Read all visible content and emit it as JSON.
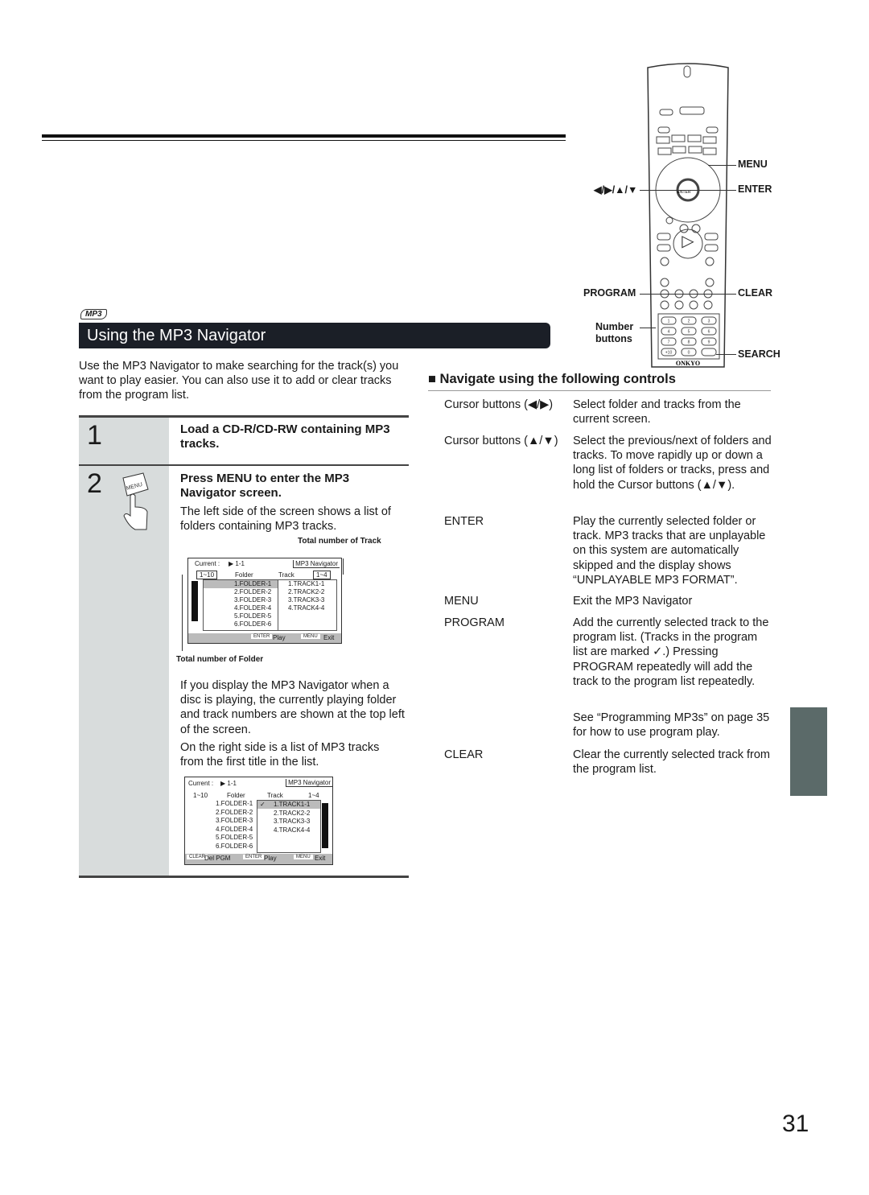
{
  "logo": "MP3",
  "title": "Using the MP3 Navigator",
  "intro": "Use the MP3 Navigator to make searching for the track(s) you want to play easier. You can also use it to add or clear tracks from the program list.",
  "steps": [
    {
      "number": "1",
      "heading": "Load a CD-R/CD-RW containing MP3 tracks."
    },
    {
      "number": "2",
      "heading": "Press MENU to enter the MP3 Navigator screen.",
      "icon_label": "MENU",
      "text1": "The left side of the screen shows a list of folders containing MP3 tracks.",
      "text2": "If you display the MP3 Navigator when a disc is playing, the currently playing folder and track numbers are shown at the top left of the screen.",
      "text3": "On the right side is a list of MP3 tracks from the first title in the list."
    }
  ],
  "callouts": {
    "tracks": "Total number of Track",
    "folders": "Total number of Folder"
  },
  "screen1": {
    "current": "Current :",
    "current_value": "▶ 1-1",
    "tab": "MP3 Navigator",
    "folder_range": "1~10",
    "folder_hdr": "Folder",
    "track_hdr": "Track",
    "track_range": "1~4",
    "folders": [
      "1.FOLDER-1",
      "2.FOLDER-2",
      "3.FOLDER-3",
      "4.FOLDER-4",
      "5.FOLDER-5",
      "6.FOLDER-6"
    ],
    "tracks": [
      "1.TRACK1-1",
      "2.TRACK2-2",
      "3.TRACK3-3",
      "4.TRACK4-4"
    ],
    "enter": "ENTER",
    "play": "Play",
    "menu": "MENU",
    "exit": "Exit"
  },
  "screen2": {
    "current": "Current :",
    "current_value": "▶ 1-1",
    "tab": "MP3 Navigator",
    "folder_range": "1~10",
    "folder_hdr": "Folder",
    "track_hdr": "Track",
    "track_range": "1~4",
    "check": "✓",
    "folders": [
      "1.FOLDER-1",
      "2.FOLDER-2",
      "3.FOLDER-3",
      "4.FOLDER-4",
      "5.FOLDER-5",
      "6.FOLDER-6"
    ],
    "tracks": [
      "1.TRACK1-1",
      "2.TRACK2-2",
      "3.TRACK3-3",
      "4.TRACK4-4"
    ],
    "clear": "CLEAR",
    "delpgm": "Del PGM",
    "enter": "ENTER",
    "play": "Play",
    "menu": "MENU",
    "exit": "Exit"
  },
  "remote": {
    "brand": "ONKYO",
    "labels": {
      "menu": "MENU",
      "enter": "ENTER",
      "cursor": "◀/▶/▲/▼",
      "program": "PROGRAM",
      "clear": "CLEAR",
      "number": "Number buttons",
      "search": "SEARCH"
    },
    "play_glyph": "▷",
    "stop_glyph": "□",
    "keys": [
      "1",
      "2",
      "3",
      "4",
      "5",
      "6",
      "7",
      "8",
      "9",
      "+10",
      "0",
      ""
    ]
  },
  "controls": {
    "heading": "■ Navigate using the following controls",
    "rows": [
      {
        "label": "Cursor buttons (◀/▶)",
        "desc": "Select folder and tracks from the current screen."
      },
      {
        "label": "Cursor buttons (▲/▼)",
        "desc": "Select the previous/next of folders and tracks. To move rapidly up or down a long list of folders or tracks, press and hold the Cursor buttons (▲/▼)."
      },
      {
        "label": "ENTER",
        "desc": "Play the currently selected folder or track. MP3 tracks that are unplayable on this system are automatically skipped and the display shows “UNPLAYABLE MP3 FORMAT”."
      },
      {
        "label": "MENU",
        "desc": "Exit the MP3 Navigator"
      },
      {
        "label": "PROGRAM",
        "desc": "Add the currently selected track to the program list. (Tracks in the program list are  marked ✓.) Pressing PROGRAM repeatedly will add the track to the program list repeatedly."
      },
      {
        "label": "",
        "desc": "See “Programming MP3s” on page 35 for how to use program play."
      },
      {
        "label": "CLEAR",
        "desc": "Clear the currently selected track from the program list."
      }
    ]
  },
  "page_number": "31"
}
